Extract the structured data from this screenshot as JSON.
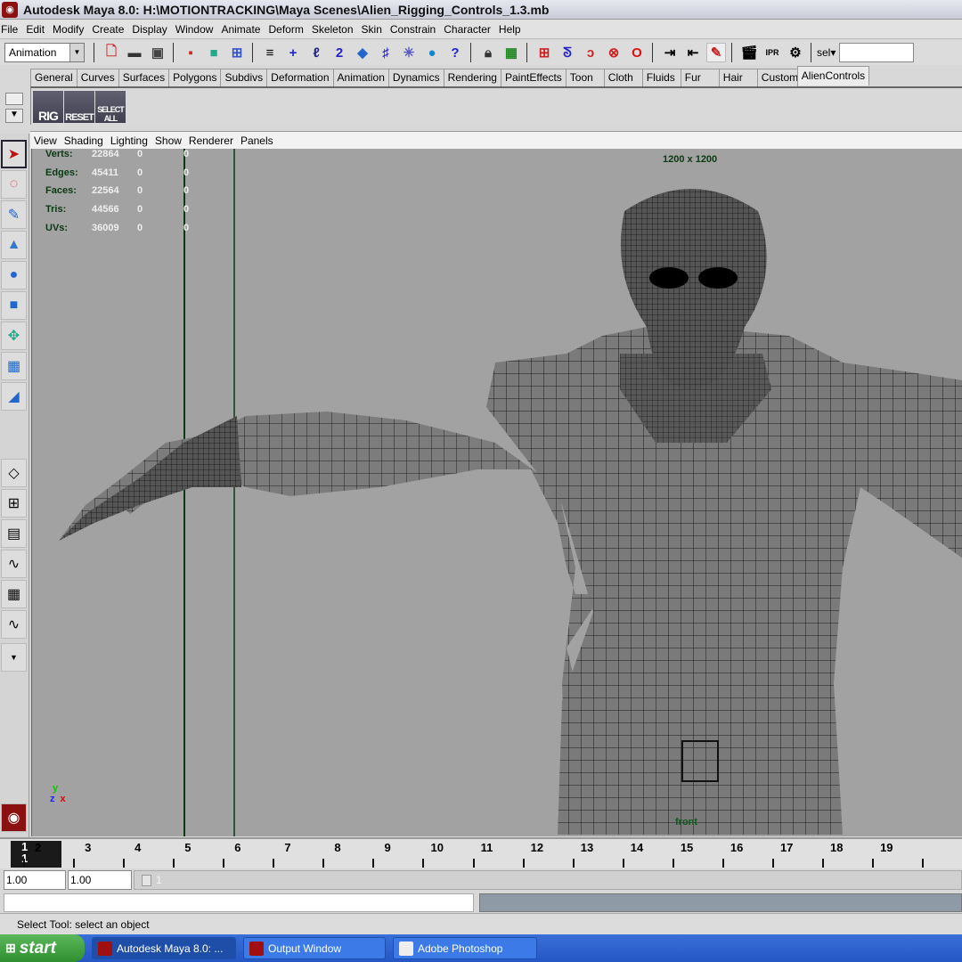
{
  "window": {
    "title": "Autodesk Maya 8.0: H:\\MOTIONTRACKING\\Maya Scenes\\Alien_Rigging_Controls_1.3.mb"
  },
  "menu": [
    "File",
    "Edit",
    "Modify",
    "Create",
    "Display",
    "Window",
    "Animate",
    "Deform",
    "Skeleton",
    "Skin",
    "Constrain",
    "Character",
    "Help"
  ],
  "toolbar": {
    "mode": "Animation",
    "sel_label": "sel▾",
    "sel_value": "",
    "icons": [
      "new-scene",
      "open-scene",
      "save-scene",
      "select-hierarchy",
      "select-object",
      "select-component",
      "snap-grid",
      "snap-curve",
      "snap-point",
      "snap-surface",
      "make-live",
      "history",
      "render",
      "ipr-render",
      "help",
      "lock",
      "select-highlight",
      "magnet-grid",
      "magnet-curve",
      "magnet-point",
      "magnet-surface",
      "magnet",
      "input-ops",
      "output-ops",
      "construction-history",
      "render-view",
      "ipr",
      "render-settings"
    ]
  },
  "shelf": {
    "tabs": [
      "General",
      "Curves",
      "Surfaces",
      "Polygons",
      "Subdivs",
      "Deformation",
      "Animation",
      "Dynamics",
      "Rendering",
      "PaintEffects",
      "Toon",
      "Cloth",
      "Fluids",
      "Fur",
      "Hair",
      "Custom",
      "AlienControls"
    ],
    "active": "AlienControls",
    "buttons": [
      "RIG",
      "RESET",
      "SELECT ALL"
    ]
  },
  "panel_menu": [
    "View",
    "Shading",
    "Lighting",
    "Show",
    "Renderer",
    "Panels"
  ],
  "hud": {
    "rows": [
      {
        "label": "Verts:",
        "value": "22864",
        "sel": "0",
        "extra": "0"
      },
      {
        "label": "Edges:",
        "value": "45411",
        "sel": "0",
        "extra": "0"
      },
      {
        "label": "Faces:",
        "value": "22564",
        "sel": "0",
        "extra": "0"
      },
      {
        "label": "Tris:",
        "value": "44566",
        "sel": "0",
        "extra": "0"
      },
      {
        "label": "UVs:",
        "value": "36009",
        "sel": "0",
        "extra": "0"
      }
    ],
    "resolution": "1200 x 1200",
    "camera": "front",
    "axis_y": "y",
    "axis_z": "z",
    "axis_x": "x"
  },
  "timeline": {
    "current": "1",
    "frames": [
      "1",
      "2",
      "3",
      "4",
      "5",
      "6",
      "7",
      "8",
      "9",
      "10",
      "11",
      "12",
      "13",
      "14",
      "15",
      "16",
      "17",
      "18",
      "19"
    ]
  },
  "range": {
    "start": "1.00",
    "current": "1.00",
    "slider_label": "1"
  },
  "help_line": "Select Tool: select an object",
  "taskbar": {
    "start": "start",
    "tasks": [
      "Autodesk Maya 8.0: ...",
      "Output Window",
      "Adobe Photoshop"
    ]
  }
}
